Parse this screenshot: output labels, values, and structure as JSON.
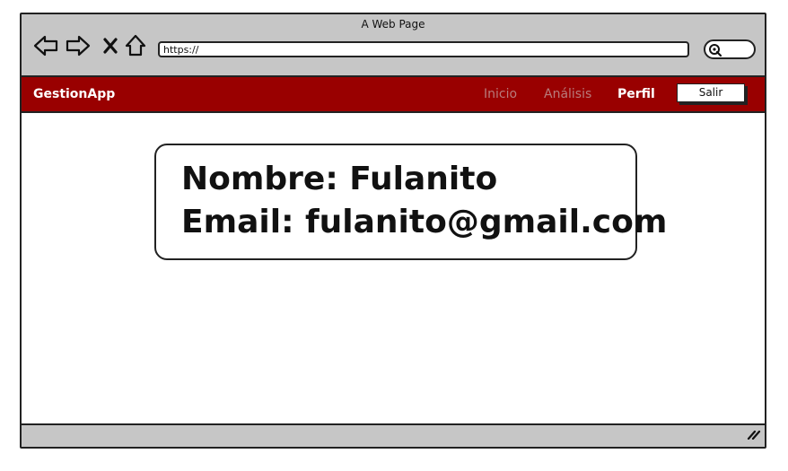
{
  "window": {
    "title": "A Web Page"
  },
  "toolbar": {
    "back_icon": "back-arrow-icon",
    "forward_icon": "forward-arrow-icon",
    "stop_icon": "close-x-icon",
    "home_icon": "home-icon",
    "url_value": "https://",
    "search_icon": "search-icon"
  },
  "navbar": {
    "brand": "GestionApp",
    "links": [
      {
        "label": "Inicio",
        "state": "inactive"
      },
      {
        "label": "Análisis",
        "state": "inactive"
      },
      {
        "label": "Perfil",
        "state": "active"
      }
    ],
    "logout_label": "Salir"
  },
  "profile": {
    "name_line": "Nombre: Fulanito",
    "email_line": "Email: fulanito@gmail.com"
  },
  "colors": {
    "navbar_bg": "#990000",
    "chrome_bg": "#c6c6c6",
    "nav_inactive": "#b87c7c",
    "nav_active": "#ffffff"
  },
  "statusbar": {
    "resize_icon": "resize-grip-icon"
  }
}
